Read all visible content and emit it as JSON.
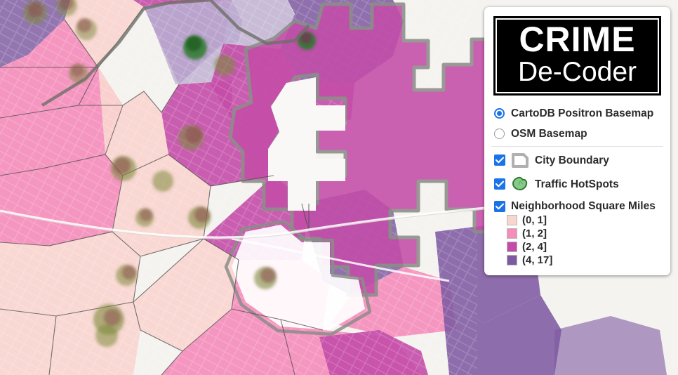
{
  "map": {
    "basemap_name": "CartoDB Positron",
    "background_color": "#f4f3ef",
    "road_color": "#ffffff",
    "boundary_color": "#8c8c88",
    "neighborhood_line_color": "#4c4c4c",
    "hotspot_fill": "#3f8f3f",
    "hotspot_core": "#8a3a3a",
    "choropleth_colors": [
      "#f9d5cf",
      "#f58cba",
      "#c44ca8",
      "#7e5aa2"
    ],
    "city_boundary_stroke": "#6e6e68"
  },
  "panel": {
    "logo": {
      "line1": "CRIME",
      "line2": "De-Coder",
      "background": "#000000",
      "text_color": "#ffffff"
    },
    "basemaps": [
      {
        "label": "CartoDB Positron Basemap",
        "selected": true
      },
      {
        "label": "OSM Basemap",
        "selected": false
      }
    ],
    "overlays": [
      {
        "label": "City Boundary",
        "checked": true,
        "icon": "city-boundary-polygon-icon"
      },
      {
        "label": "Traffic HotSpots",
        "checked": true,
        "icon": "hotspot-blob-icon"
      },
      {
        "label": "Neighborhood Square Miles",
        "checked": true,
        "icon": "none"
      }
    ],
    "legend": {
      "title": "Neighborhood Square Miles",
      "items": [
        {
          "label": "(0, 1]",
          "color": "#f9d5cf"
        },
        {
          "label": "(1, 2]",
          "color": "#f58cba"
        },
        {
          "label": "(2, 4]",
          "color": "#c44ca8"
        },
        {
          "label": "(4, 17]",
          "color": "#7e5aa2"
        }
      ]
    },
    "accent_color": "#1a73e8"
  }
}
